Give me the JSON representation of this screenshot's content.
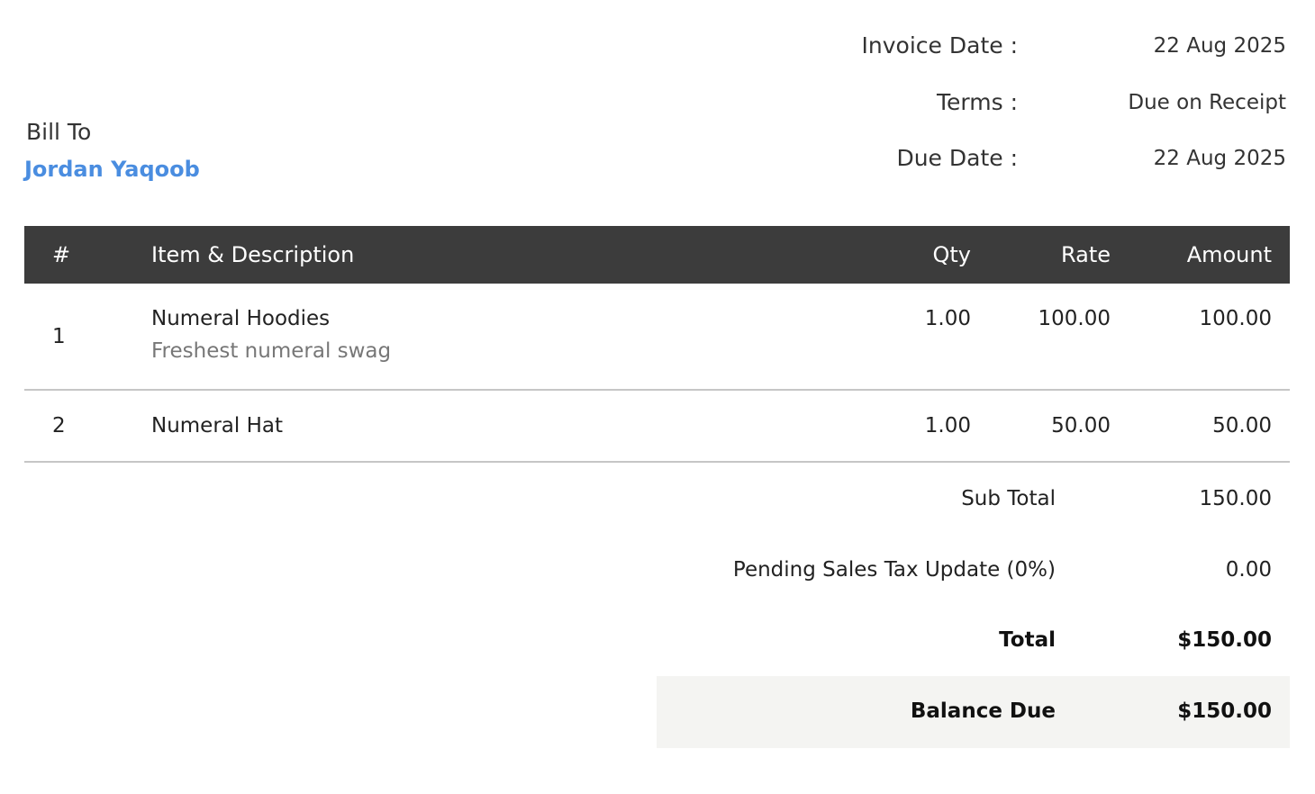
{
  "invoice_meta": {
    "invoice_date": {
      "label": "Invoice Date :",
      "value": "22 Aug 2025"
    },
    "terms": {
      "label": "Terms :",
      "value": "Due on Receipt"
    },
    "due_date": {
      "label": "Due Date :",
      "value": "22 Aug 2025"
    }
  },
  "bill_to": {
    "label": "Bill To",
    "name": "Jordan Yaqoob",
    "name_color": "#4a8de0"
  },
  "table": {
    "headers": {
      "num": "#",
      "item": "Item & Description",
      "qty": "Qty",
      "rate": "Rate",
      "amount": "Amount"
    },
    "header_bg": "#3c3c3c",
    "rows": [
      {
        "num": "1",
        "item": "Numeral Hoodies",
        "description": "Freshest numeral swag",
        "qty": "1.00",
        "rate": "100.00",
        "amount": "100.00"
      },
      {
        "num": "2",
        "item": "Numeral Hat",
        "description": "",
        "qty": "1.00",
        "rate": "50.00",
        "amount": "50.00"
      }
    ]
  },
  "totals": {
    "sub_total": {
      "label": "Sub Total",
      "value": "150.00"
    },
    "tax": {
      "label": "Pending Sales Tax Update (0%)",
      "value": "0.00"
    },
    "total": {
      "label": "Total",
      "value": "$150.00"
    },
    "balance_due": {
      "label": "Balance Due",
      "value": "$150.00"
    }
  }
}
